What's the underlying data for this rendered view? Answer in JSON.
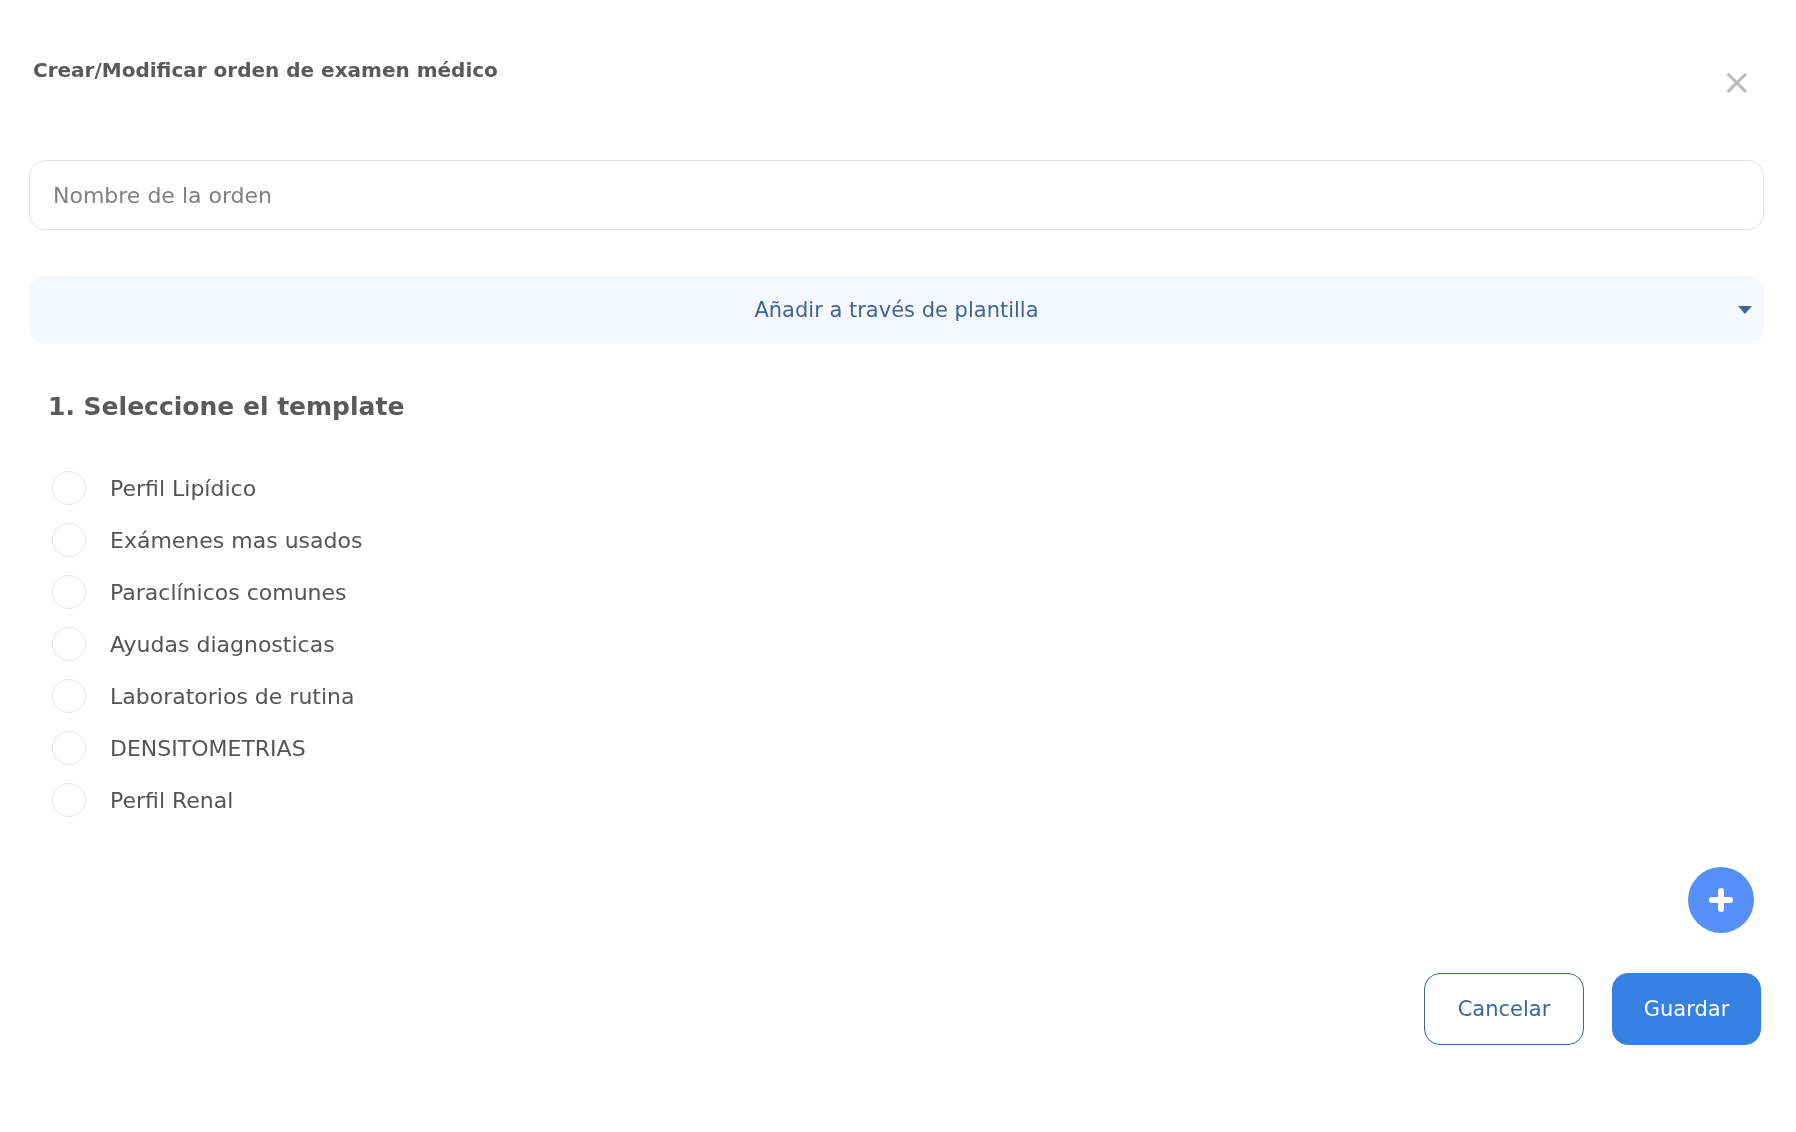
{
  "dialog": {
    "title": "Crear/Modificar orden de examen médico",
    "close": "×"
  },
  "order_name": {
    "placeholder": "Nombre de la orden"
  },
  "template_dropdown": {
    "label": "Añadir a través de plantilla",
    "expanded": true
  },
  "section_title": "1. Seleccione el template",
  "templates": [
    {
      "label": "Perfil Lipídico",
      "selected": false
    },
    {
      "label": "Exámenes mas usados",
      "selected": false
    },
    {
      "label": "Paraclínicos comunes",
      "selected": false
    },
    {
      "label": "Ayudas diagnosticas",
      "selected": false
    },
    {
      "label": "Laboratorios de rutina",
      "selected": false
    },
    {
      "label": "DENSITOMETRIAS",
      "selected": false
    },
    {
      "label": "Perfil Renal",
      "selected": false
    }
  ],
  "buttons": [
    {
      "label": "Cancelar",
      "kind": "secondary"
    },
    {
      "label": "Guardar",
      "kind": "primary"
    }
  ]
}
